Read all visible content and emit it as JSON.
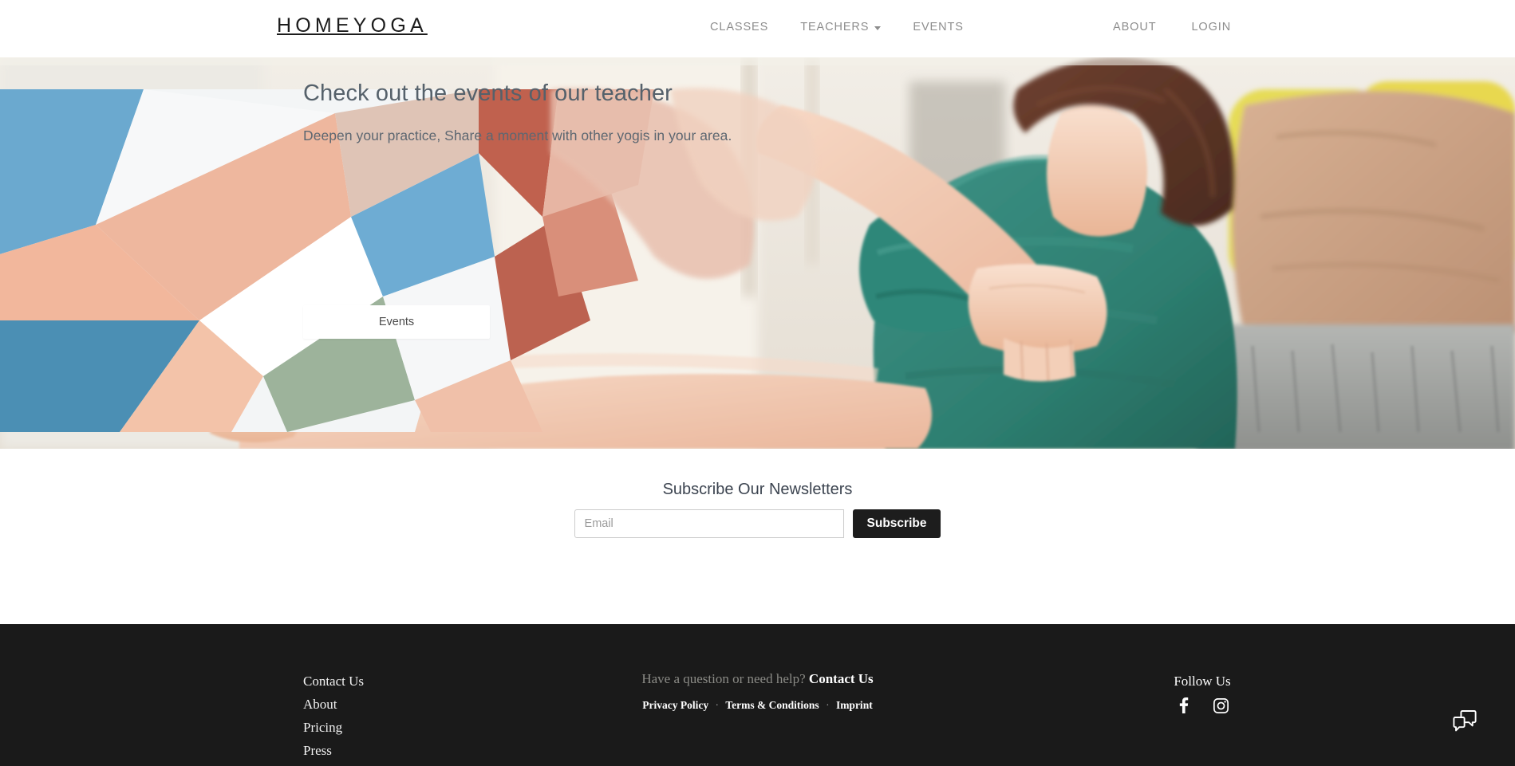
{
  "header": {
    "brand": "HOMEYOGA",
    "nav_center": [
      {
        "label": "CLASSES",
        "has_dropdown": false,
        "icon": ""
      },
      {
        "label": "TEACHERS",
        "has_dropdown": true,
        "icon": "chevron-down-icon"
      },
      {
        "label": "EVENTS",
        "has_dropdown": false,
        "icon": ""
      }
    ],
    "nav_right": [
      {
        "label": "ABOUT"
      },
      {
        "label": "LOGIN"
      }
    ]
  },
  "hero": {
    "title": "Check out the events of our teacher",
    "subtitle": "Deepen your practice, Share a moment with other yogis in your area.",
    "cta_label": "Events",
    "image_alt": "Yoga teacher adjusting a student's shoulder on a sofa",
    "colors": {
      "title": "#55616b",
      "subtitle": "#5d6771",
      "cta_bg": "#ffffff",
      "cta_text": "#4a4a4a",
      "legging_blue": "#6ba9cf",
      "legging_peach": "#f0b9a3",
      "legging_white": "#f4f6f7",
      "legging_sage": "#9db39b",
      "legging_rust": "#c0614e",
      "shirt_teal": "#2f8476",
      "skin": "#f1c9b4",
      "pillow_yellow": "#e8d84f",
      "pillow_tan": "#c9a184",
      "sofa_grey": "#a8aaa8",
      "wall": "#ece7df"
    }
  },
  "newsletter": {
    "title": "Subscribe Our Newsletters",
    "email_placeholder": "Email",
    "email_value": "",
    "submit_label": "Subscribe",
    "submit_bg": "#1d1d1d"
  },
  "footer": {
    "background": "#1a1a1a",
    "links": [
      {
        "label": "Contact Us"
      },
      {
        "label": "About"
      },
      {
        "label": "Pricing"
      },
      {
        "label": "Press"
      }
    ],
    "help_text": "Have a question or need help?",
    "help_cta": "Contact Us",
    "legal": [
      {
        "label": "Privacy Policy"
      },
      {
        "label": "Terms & Conditions"
      },
      {
        "label": "Imprint"
      }
    ],
    "legal_separator": "·",
    "follow_title": "Follow Us",
    "social": [
      {
        "icon": "facebook-icon",
        "label": "Facebook"
      },
      {
        "icon": "instagram-icon",
        "label": "Instagram"
      }
    ],
    "chat_icon": "chat-bubbles-icon"
  }
}
